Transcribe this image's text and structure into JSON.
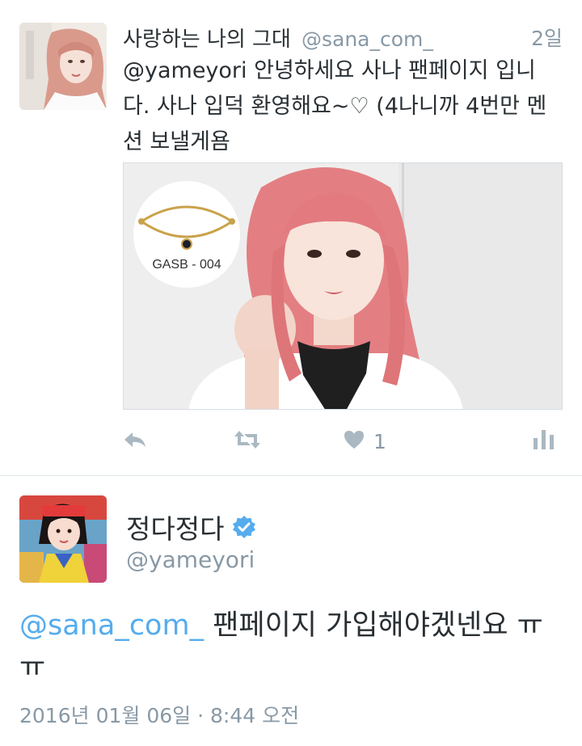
{
  "tweet1": {
    "display_name": "사랑하는 나의 그대",
    "handle": "@sana_com_",
    "time": "2일",
    "text": "@yameyori 안녕하세요 사나 팬페이지 입니다. 사나 입덕 환영해요~♡ (4나니까 4번만 멘션 보낼게욤",
    "media": {
      "product_code": "GASB - 004"
    },
    "actions": {
      "reply_icon": "reply-icon",
      "retweet_icon": "retweet-icon",
      "like_icon": "heart-icon",
      "like_count": "1",
      "analytics_icon": "analytics-icon"
    }
  },
  "tweet2": {
    "display_name": "정다정다",
    "verified_icon": "verified-badge-icon",
    "handle": "@yameyori",
    "mention": "@sana_com_",
    "text_after_mention": " 팬페이지 가입해야겠넨요 ㅠㅠ",
    "date": "2016년 01월 06일",
    "separator": " · ",
    "time": "8:44 오전"
  },
  "colors": {
    "link": "#55acee",
    "muted": "#8899a6",
    "text": "#292f33",
    "divider": "#e1e8ed",
    "action_icon": "#aab8c2"
  }
}
